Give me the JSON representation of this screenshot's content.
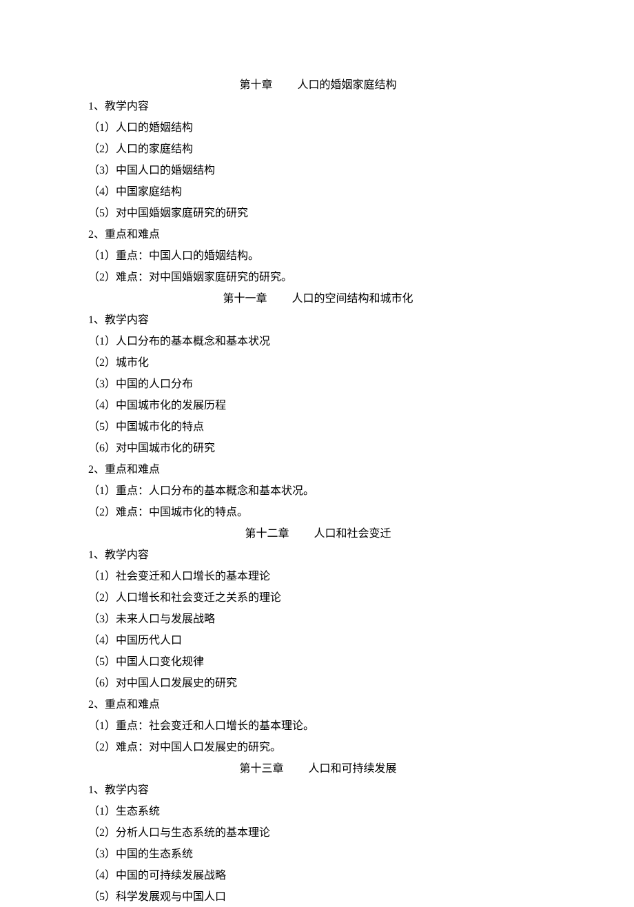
{
  "chapters": [
    {
      "title_num": "第十章",
      "title_text": "人口的婚姻家庭结构",
      "section1_label": "1、教学内容",
      "items1": [
        "（1）人口的婚姻结构",
        "（2）人口的家庭结构",
        "（3）中国人口的婚姻结构",
        "（4）中国家庭结构",
        "（5）对中国婚姻家庭研究的研究"
      ],
      "section2_label": "2、重点和难点",
      "items2": [
        "（1）重点：中国人口的婚姻结构。",
        "（2）难点：对中国婚姻家庭研究的研究。"
      ]
    },
    {
      "title_num": "第十一章",
      "title_text": "人口的空间结构和城市化",
      "section1_label": "1、教学内容",
      "items1": [
        "（1）人口分布的基本概念和基本状况",
        "（2）城市化",
        "（3）中国的人口分布",
        "（4）中国城市化的发展历程",
        "（5）中国城市化的特点",
        "（6）对中国城市化的研究"
      ],
      "section2_label": "2、重点和难点",
      "items2": [
        "（1）重点：人口分布的基本概念和基本状况。",
        "（2）难点：中国城市化的特点。"
      ]
    },
    {
      "title_num": "第十二章",
      "title_text": "人口和社会变迁",
      "section1_label": "1、教学内容",
      "items1": [
        "（1）社会变迁和人口增长的基本理论",
        "（2）人口增长和社会变迁之关系的理论",
        "（3）未来人口与发展战略",
        "（4）中国历代人口",
        "（5）中国人口变化规律",
        "（6）对中国人口发展史的研究"
      ],
      "section2_label": "2、重点和难点",
      "items2": [
        "（1）重点：社会变迁和人口增长的基本理论。",
        "（2）难点：对中国人口发展史的研究。"
      ]
    },
    {
      "title_num": "第十三章",
      "title_text": "人口和可持续发展",
      "section1_label": "1、教学内容",
      "items1": [
        "（1）生态系统",
        "（2）分析人口与生态系统的基本理论",
        "（3）中国的生态系统",
        "（4）中国的可持续发展战略",
        "（5）科学发展观与中国人口"
      ],
      "section2_label": "",
      "items2": []
    }
  ]
}
